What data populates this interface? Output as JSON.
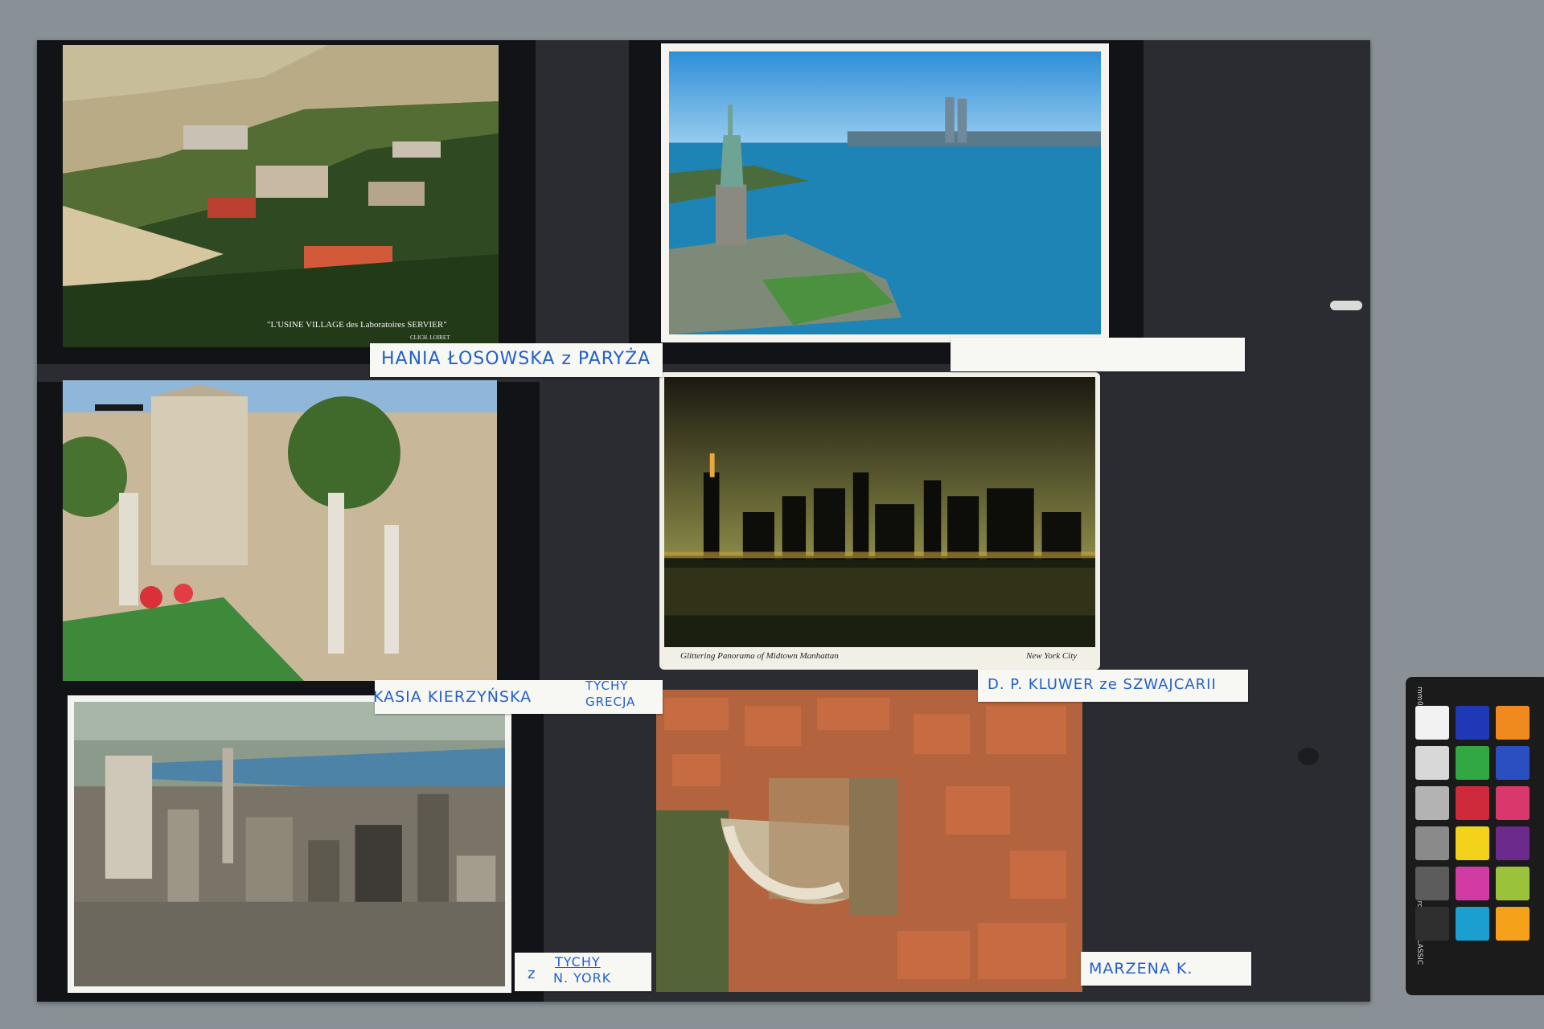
{
  "postcards": {
    "servier": {
      "caption": "\"L'USINE VILLAGE des Laboratoires SERVIER\"",
      "credit": "CLICH. LOIRET"
    },
    "manhattan_night": {
      "caption_left": "Glittering Panorama of Midtown Manhattan",
      "caption_right": "New York City"
    }
  },
  "labels": {
    "label1": "HANIA ŁOSOWSKA z PARYŻA",
    "label3": "KASIA KIERZYŃSKA",
    "label3_line1": "TYCHY",
    "label3_line2": "GRECJA",
    "label4": "D. P. KLUWER ze SZWAJCARII",
    "label5_z": "z",
    "label5_line1": "TYCHY",
    "label5_line2": "N. YORK",
    "label6": "MARZENA K."
  },
  "color_checker": {
    "brand": "colorchecker CLASSIC",
    "ruler_unit": "mm",
    "id": "02/22",
    "patches": [
      "#f2f2f2",
      "#1f38b6",
      "#f08a1f",
      "#d8d8d8",
      "#32a844",
      "#2b4fc0",
      "#b3b3b3",
      "#cf2a3c",
      "#d9386c",
      "#8a8a8a",
      "#f2d21a",
      "#6c2a8c",
      "#5c5c5c",
      "#d23aa4",
      "#9ac23a",
      "#2f2f2f",
      "#1a9fd0",
      "#f5a21a"
    ]
  }
}
